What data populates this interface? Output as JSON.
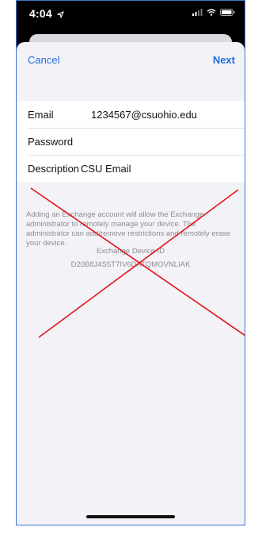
{
  "status_bar": {
    "time": "4:04",
    "location_icon": "location-arrow-icon",
    "signal_icon": "cellular-signal-icon",
    "wifi_icon": "wifi-icon",
    "battery_icon": "battery-icon"
  },
  "nav": {
    "cancel_label": "Cancel",
    "next_label": "Next",
    "accent_color": "#1e6fd9"
  },
  "form": {
    "email_label": "Email",
    "email_value": "1234567@csuohio.edu",
    "password_label": "Password",
    "password_value": "",
    "description_label": "Description",
    "description_value": "CSU Email"
  },
  "footer": {
    "notice": "Adding an Exchange account will allow the Exchange administrator to remotely manage your device. The administrator can add/remove restrictions and remotely erase your device.",
    "device_id_label": "Exchange Device ID",
    "device_id_value": "D20B8J4S5T7IV6DATQMOVNLIAK"
  },
  "overlay": {
    "cross_color": "#e3141b"
  }
}
